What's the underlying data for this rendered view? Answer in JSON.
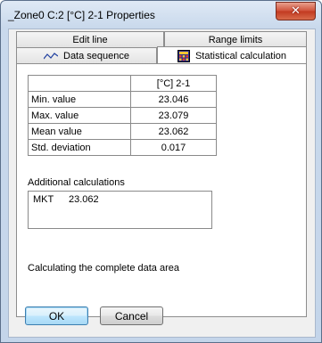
{
  "window": {
    "title": "_Zone0 C:2 [°C] 2-1 Properties",
    "close_glyph": "✕"
  },
  "tabs": [
    {
      "label": "Edit line",
      "active": false
    },
    {
      "label": "Range limits",
      "active": false
    },
    {
      "label": "Data sequence",
      "icon": "line-graph-icon",
      "active": false
    },
    {
      "label": "Statistical calculation",
      "icon": "calculator-icon",
      "active": true
    }
  ],
  "stats": {
    "column_header": "[°C] 2-1",
    "rows": [
      {
        "label": "Min. value",
        "value": "23.046"
      },
      {
        "label": "Max. value",
        "value": "23.079"
      },
      {
        "label": "Mean value",
        "value": "23.062"
      },
      {
        "label": "Std. deviation",
        "value": "0.017"
      }
    ]
  },
  "additional": {
    "heading": "Additional calculations",
    "mkt_label": "MKT",
    "mkt_value": "23.062"
  },
  "note": "Calculating the complete data area",
  "buttons": {
    "ok": "OK",
    "cancel": "Cancel"
  },
  "colors": {
    "title_gradient_top": "#dfe9f5",
    "close_red": "#c23a20",
    "default_button_blue": "#3c7fb1"
  }
}
